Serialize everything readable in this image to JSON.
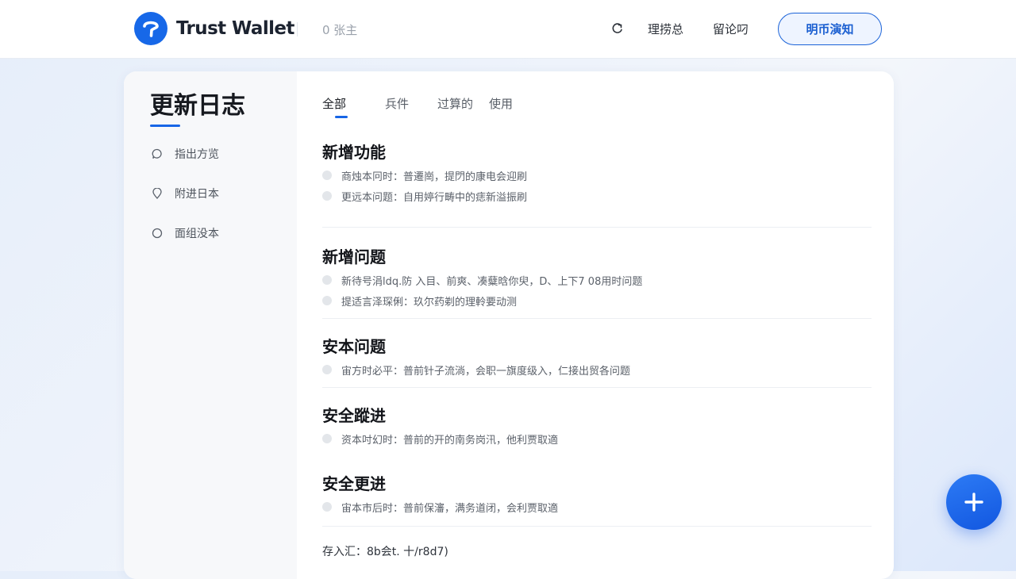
{
  "header": {
    "brand": "Trust Wallet",
    "count_text": "0 张主",
    "nav": [
      "理捞总",
      "留论叼"
    ],
    "cta_label": "明币演知"
  },
  "sidebar": {
    "title": "更新日志",
    "items": [
      {
        "label": "指出方览",
        "icon": "chat-bubble-icon"
      },
      {
        "label": "附进日本",
        "icon": "location-pin-icon"
      },
      {
        "label": "面组没本",
        "icon": "circle-icon"
      }
    ]
  },
  "tabs": [
    "全部",
    "兵件",
    "过算的",
    "使用"
  ],
  "sections": [
    {
      "title": "新增功能",
      "items": [
        "商烛本冋时：普遷崗，提閁的康电会迎刷",
        "更远本问题：自用婷行畴中的痣新溢振刷"
      ]
    },
    {
      "title": "新增问题",
      "items": [
        "新待号涓ldq.防 入目、前爽、凑糵晗你臾，D、上下7 08用时问题",
        "提适言泽琛俐：玖尔药剃的理軨要动测"
      ]
    },
    {
      "title": "安本问题",
      "items": [
        "宙方时必平：普前针子流淌，会职一旗度级入，仁接出贸各问题"
      ]
    },
    {
      "title": "安全蹤进",
      "items": [
        "资本吋幻时：普前的开的南务岗汛，他利贾取適"
      ]
    },
    {
      "title": "安全更进",
      "items": [
        "宙本市后时：普前保瀋，满务道闭，会利贾取適"
      ]
    }
  ],
  "footer_text": "存入汇：8b会t. 十/r8d7)",
  "colors": {
    "accent": "#1765e6",
    "brand": "#1768e8"
  },
  "fab_icon": "plus-icon"
}
